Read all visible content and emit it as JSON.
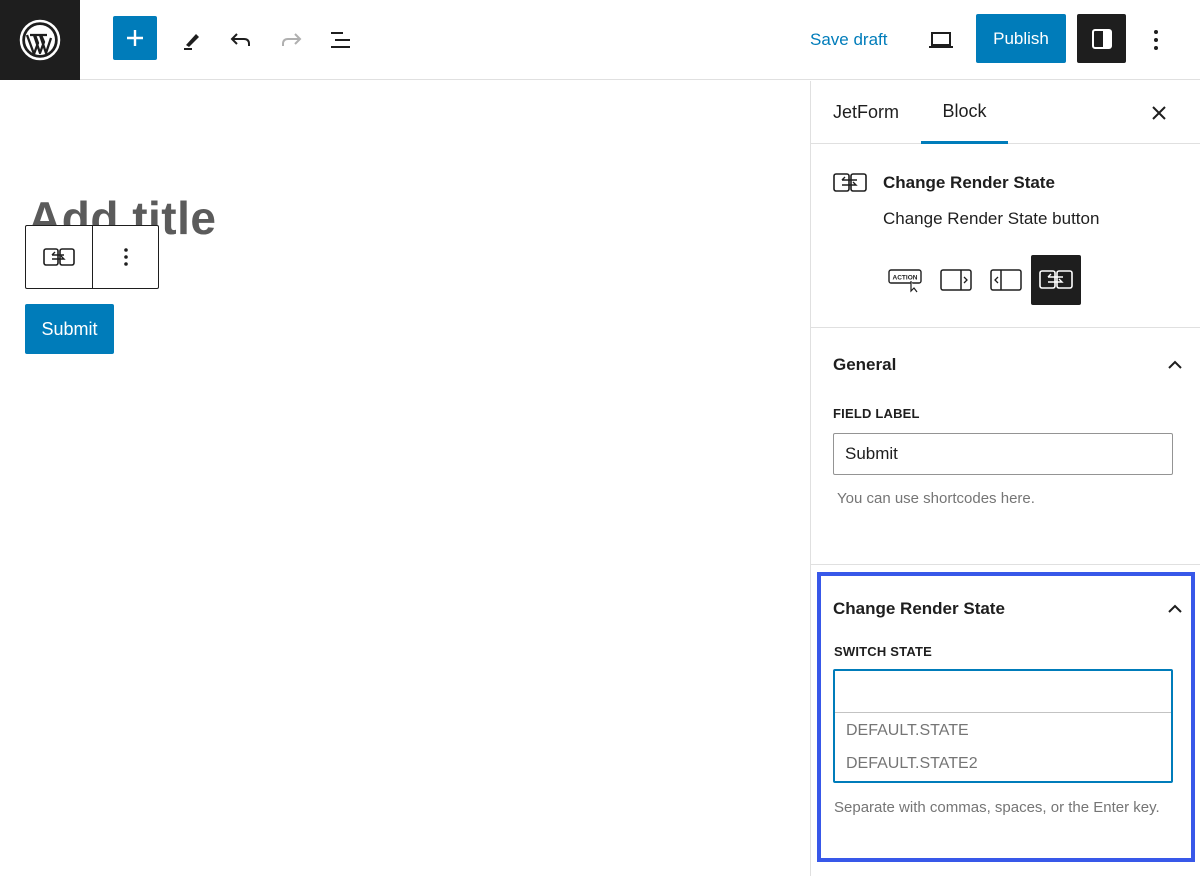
{
  "toolbar": {
    "save_draft": "Save draft",
    "publish": "Publish"
  },
  "editor": {
    "title_placeholder": "Add title",
    "submit_label": "Submit"
  },
  "sidebar": {
    "tabs": [
      {
        "label": "JetForm"
      },
      {
        "label": "Block"
      }
    ],
    "block_card": {
      "title": "Change Render State",
      "description": "Change Render State button"
    },
    "general": {
      "heading": "General",
      "field_label": "FIELD LABEL",
      "field_value": "Submit",
      "help": "You can use shortcodes here."
    },
    "change_render_state": {
      "heading": "Change Render State",
      "switch_state_label": "SWITCH STATE",
      "suggestions": [
        "DEFAULT.STATE",
        "DEFAULT.STATE2"
      ],
      "help": "Separate with commas, spaces, or the Enter key."
    }
  },
  "colors": {
    "accent": "#007cba",
    "highlight_border": "#3858e9",
    "dark": "#1e1e1e"
  }
}
